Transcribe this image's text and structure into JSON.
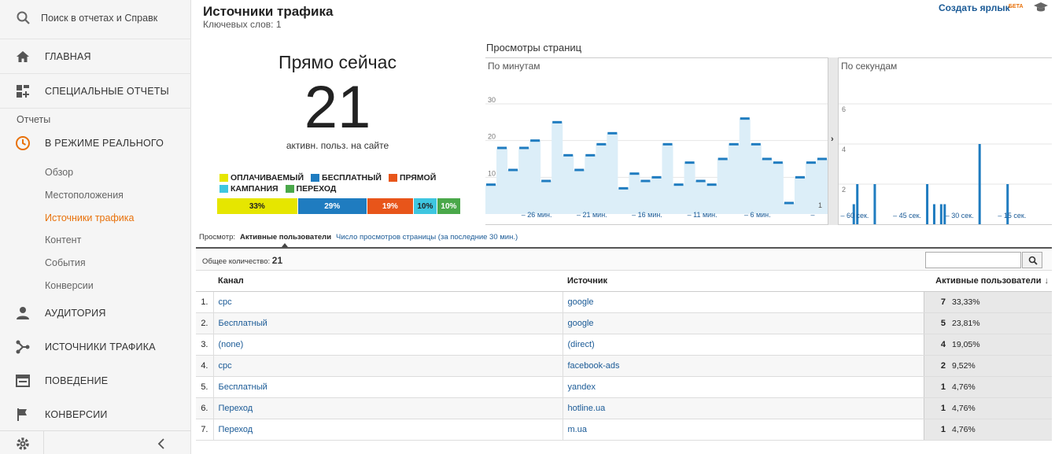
{
  "sidebar": {
    "search_placeholder": "Поиск в отчетах и Справк",
    "nav": {
      "home": "ГЛАВНАЯ",
      "custom": "СПЕЦИАЛЬНЫЕ ОТЧЕТЫ",
      "section": "Отчеты",
      "realtime": "В РЕЖИМЕ РЕАЛЬНОГО",
      "audience": "АУДИТОРИЯ",
      "acquisition": "ИСТОЧНИКИ ТРАФИКА",
      "behavior": "ПОВЕДЕНИЕ",
      "conversions": "КОНВЕРСИИ"
    },
    "realtime_items": [
      "Обзор",
      "Местоположения",
      "Источники трафика",
      "Контент",
      "События",
      "Конверсии"
    ]
  },
  "header": {
    "title": "Источники трафика",
    "subtitle": "Ключевых слов: 1",
    "shortcut": "Создать ярлык",
    "beta": "БЕТА"
  },
  "right_now": {
    "title": "Прямо сейчас",
    "count": "21",
    "label": "активн. польз. на сайте",
    "legend": [
      {
        "label": "ОПЛАЧИВАЕМЫЙ",
        "color": "#e6e600"
      },
      {
        "label": "БЕСПЛАТНЫЙ",
        "color": "#1f7cc0"
      },
      {
        "label": "ПРЯМОЙ",
        "color": "#e8551a"
      },
      {
        "label": "КАМПАНИЯ",
        "color": "#3ec6e0"
      },
      {
        "label": "ПЕРЕХОД",
        "color": "#4aa84a"
      }
    ],
    "shares": [
      {
        "label": "33%",
        "value": 33.33,
        "color": "#e6e600"
      },
      {
        "label": "29%",
        "value": 28.57,
        "color": "#1f7cc0"
      },
      {
        "label": "19%",
        "value": 19.05,
        "color": "#e8551a"
      },
      {
        "label": "10%",
        "value": 9.52,
        "color": "#3ec6e0"
      },
      {
        "label": "10%",
        "value": 9.52,
        "color": "#4aa84a"
      }
    ]
  },
  "chart_data": [
    {
      "type": "bar",
      "title": "Просмотры страниц",
      "subtitle": "По минутам",
      "ylim": [
        0,
        30
      ],
      "yticks": [
        "30",
        "20",
        "10"
      ],
      "x_ticks": [
        "– 26 мин.",
        "– 21 мин.",
        "– 16 мин.",
        "– 11 мин.",
        "– 6 мин.",
        "–"
      ],
      "x_tick_minutes": [
        -26,
        -21,
        -16,
        -11,
        -6,
        -1
      ],
      "values": [
        8,
        18,
        12,
        18,
        20,
        9,
        25,
        16,
        12,
        16,
        19,
        22,
        7,
        11,
        9,
        10,
        19,
        8,
        14,
        9,
        8,
        15,
        19,
        26,
        19,
        15,
        14,
        3,
        10,
        14,
        15
      ],
      "trailing_label": "1"
    },
    {
      "type": "bar",
      "title": "Просмотры страниц",
      "subtitle": "По секундам",
      "ylim": [
        0,
        6
      ],
      "yticks": [
        "6",
        "4",
        "2"
      ],
      "x_ticks": [
        "– 60 сек.",
        "– 45 сек.",
        "– 30 сек.",
        "– 15 сек."
      ],
      "bars": [
        {
          "sec": 57,
          "value": 1
        },
        {
          "sec": 56,
          "value": 2
        },
        {
          "sec": 51,
          "value": 2
        },
        {
          "sec": 36,
          "value": 2
        },
        {
          "sec": 34,
          "value": 1
        },
        {
          "sec": 32,
          "value": 1
        },
        {
          "sec": 31,
          "value": 1
        },
        {
          "sec": 21,
          "value": 4
        },
        {
          "sec": 13,
          "value": 2
        }
      ]
    }
  ],
  "view": {
    "label": "Просмотр:",
    "active": "Активные пользователи",
    "alt": "Число просмотров страницы (за последние 30 мин.)"
  },
  "table": {
    "total_label": "Общее количество:",
    "total": "21",
    "headers": {
      "channel": "Канал",
      "source": "Источник",
      "users": "Активные пользователи"
    },
    "rows": [
      {
        "idx": "1.",
        "channel": "cpc",
        "source": "google",
        "users": "7",
        "pct": "33,33%"
      },
      {
        "idx": "2.",
        "channel": "Бесплатный",
        "source": "google",
        "users": "5",
        "pct": "23,81%"
      },
      {
        "idx": "3.",
        "channel": "(none)",
        "source": "(direct)",
        "users": "4",
        "pct": "19,05%"
      },
      {
        "idx": "4.",
        "channel": "cpc",
        "source": "facebook-ads",
        "users": "2",
        "pct": "9,52%"
      },
      {
        "idx": "5.",
        "channel": "Бесплатный",
        "source": "yandex",
        "users": "1",
        "pct": "4,76%"
      },
      {
        "idx": "6.",
        "channel": "Переход",
        "source": "hotline.ua",
        "users": "1",
        "pct": "4,76%"
      },
      {
        "idx": "7.",
        "channel": "Переход",
        "source": "m.ua",
        "users": "1",
        "pct": "4,76%"
      }
    ]
  }
}
